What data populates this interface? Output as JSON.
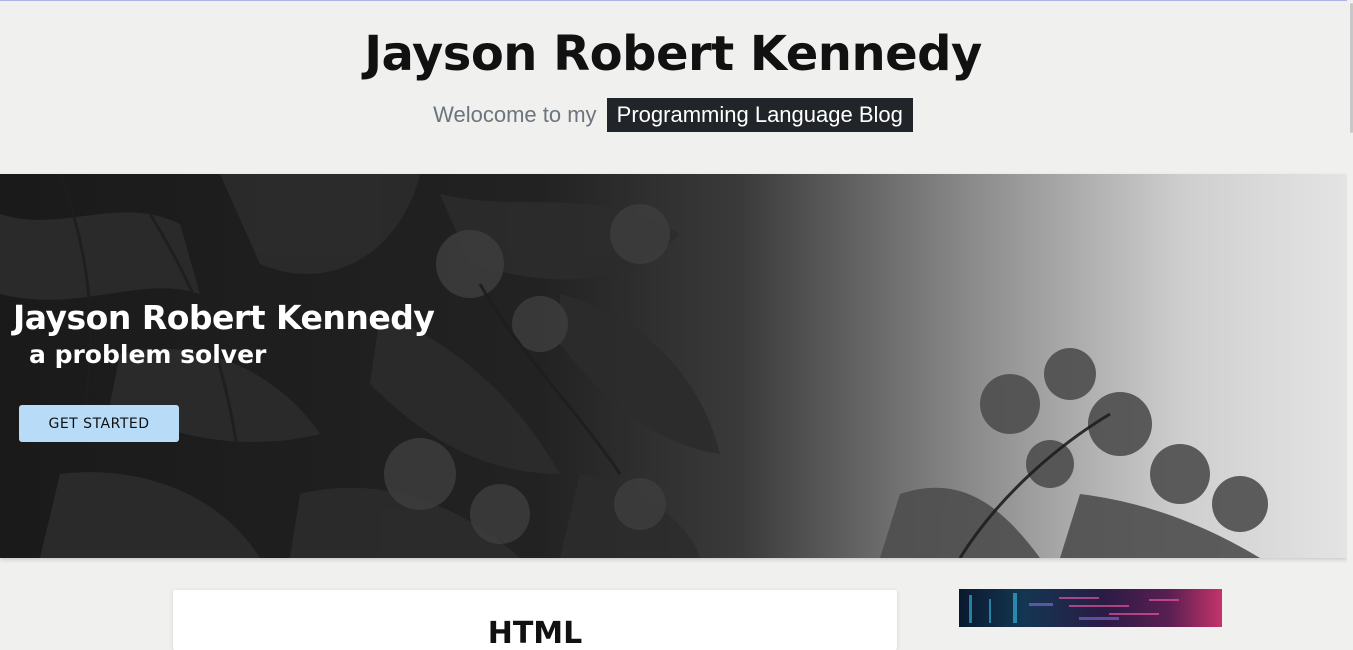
{
  "header": {
    "title": "Jayson Robert Kennedy",
    "tagline_prefix": "Welocome to my",
    "tagline_badge": "Programming Language Blog"
  },
  "hero": {
    "title": "Jayson Robert Kennedy",
    "subtitle": "a problem solver",
    "cta_label": "GET STARTED"
  },
  "posts": [
    {
      "title": "HTML"
    }
  ],
  "colors": {
    "page_bg": "#f0f0ee",
    "badge_bg": "#212529",
    "cta_bg": "#b8dcf8",
    "tagline_muted": "#6c757d"
  }
}
